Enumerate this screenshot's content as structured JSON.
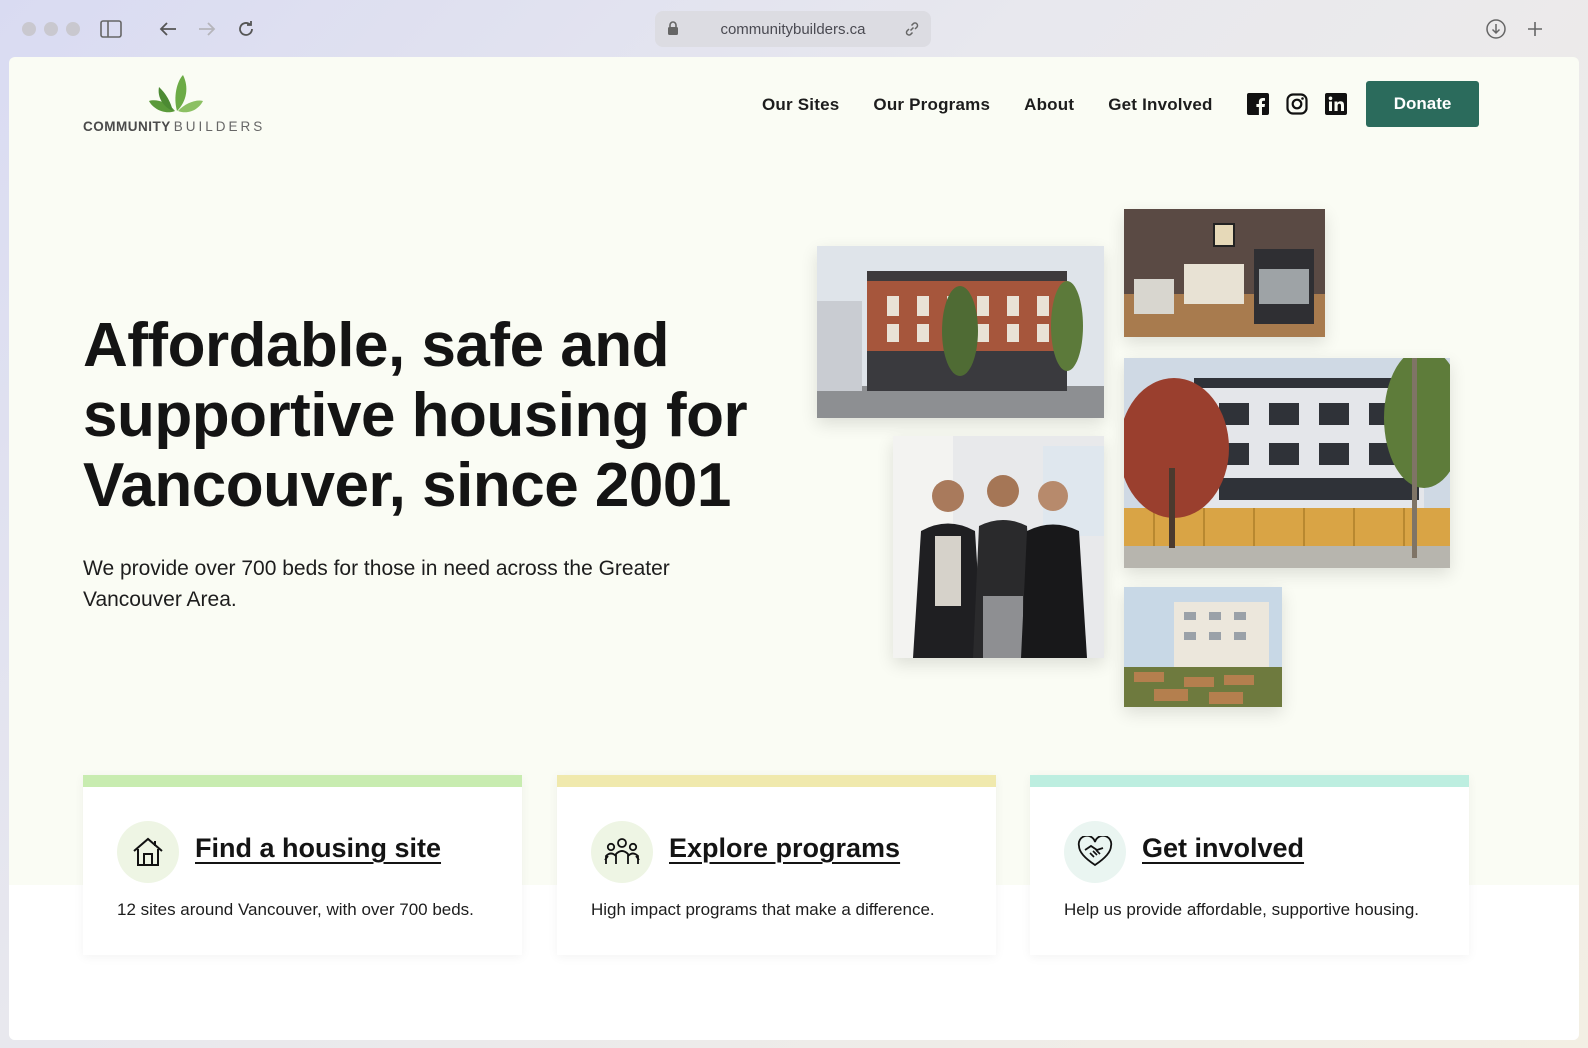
{
  "browser": {
    "url": "communitybuilders.ca"
  },
  "logo": {
    "word1": "COMMUNITY",
    "word2": "BUILDERS"
  },
  "nav": {
    "items": [
      "Our Sites",
      "Our Programs",
      "About",
      "Get Involved"
    ],
    "donate_label": "Donate"
  },
  "hero": {
    "title_parts": [
      "Affordable",
      ", ",
      "safe",
      " and ",
      "supportive",
      " housing for Vancouver, since 2001"
    ],
    "subtitle": "We provide over 700 beds for those in need across the Greater Vancouver Area."
  },
  "cards": [
    {
      "title": "Find a housing site",
      "desc": "12 sites around Vancouver, with over 700 beds.",
      "accent": "#c8ecb0",
      "icon": "house-icon"
    },
    {
      "title": "Explore programs",
      "desc": "High impact programs that make a difference.",
      "accent": "#f0e9ad",
      "icon": "people-icon"
    },
    {
      "title": "Get involved",
      "desc": "Help us provide affordable, supportive housing.",
      "accent": "#bdeee0",
      "icon": "heart-handshake-icon"
    }
  ],
  "colors": {
    "brand_green": "#2b6b5c",
    "page_bg": "#fafcf4"
  }
}
